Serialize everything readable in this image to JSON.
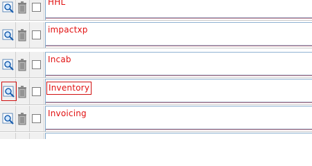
{
  "rows": [
    {
      "name": "HHL"
    },
    {
      "name": "impactxp"
    },
    {
      "name": "Incab"
    },
    {
      "name": "Inventory"
    },
    {
      "name": "Invoicing"
    },
    {
      "name": "..."
    }
  ],
  "icons": {
    "view": "magnifier-icon",
    "delete": "trash-icon"
  },
  "colors": {
    "name_text": "#e11010",
    "control_bg": "#f0f0f0",
    "cell_border": "#8fb2d2",
    "focus_outline": "#d01010"
  }
}
